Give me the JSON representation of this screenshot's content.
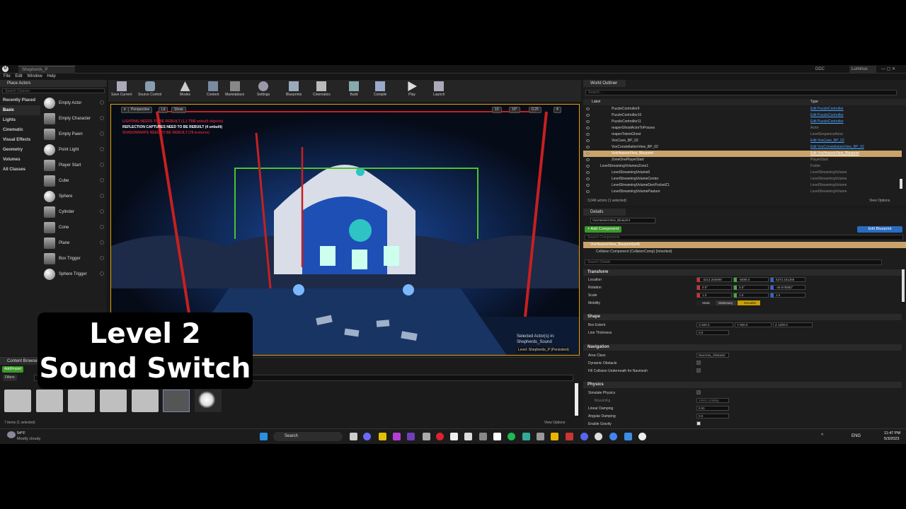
{
  "window": {
    "tab_title": "Shepherds_P",
    "ddc": "DDC",
    "project": "Luminus"
  },
  "menu": [
    "File",
    "Edit",
    "Window",
    "Help"
  ],
  "place_actors": {
    "tab": "Place Actors",
    "search_placeholder": "Search Classes",
    "categories": [
      "Recently Placed",
      "Basic",
      "Lights",
      "Cinematic",
      "Visual Effects",
      "Geometry",
      "Volumes",
      "All Classes"
    ],
    "selected_category": "Basic",
    "items": [
      "Empty Actor",
      "Empty Character",
      "Empty Pawn",
      "Point Light",
      "Player Start",
      "Cube",
      "Sphere",
      "Cylinder",
      "Cone",
      "Plane",
      "Box Trigger",
      "Sphere Trigger"
    ]
  },
  "toolbar": [
    "Save Current",
    "Source Control",
    "Modes",
    "Content",
    "Marketplace",
    "Settings",
    "Blueprints",
    "Cinematics",
    "Build",
    "Compile",
    "Play",
    "Launch"
  ],
  "viewport": {
    "perspective": "Perspective",
    "lit": "Lit",
    "show": "Show",
    "snap_values": [
      "10",
      "10°",
      "0.25",
      "4"
    ],
    "warnings": [
      "LIGHTING NEEDS TO BE REBUILT (1.1 TBB unbuilt objects)",
      "REFLECTION CAPTURES NEED TO BE REBUILT (4 unbuilt)",
      "SHADOWMAPS NEED TO BE REBUILT (78 textures)"
    ],
    "selected_label": "Selected Actor(s) in:",
    "selected_value": "Shepherds_Sound",
    "level_label": "Level:  Shepherds_P (Persistent)"
  },
  "content_browser": {
    "tab": "Content Browser",
    "add_import": "Add/Import",
    "filters": "Filters",
    "status": "7 items (1 selected)",
    "view_options": "View Options"
  },
  "overlay": {
    "line1": "Level 2",
    "line2": "Sound Switch"
  },
  "outliner": {
    "tab": "World Outliner",
    "search_placeholder": "Search...",
    "col_label": "Label",
    "col_type": "Type",
    "rows": [
      {
        "label": "PuzzleController9",
        "type": "Edit PuzzleController",
        "link": true,
        "indent": 1
      },
      {
        "label": "PuzzleController10",
        "type": "Edit PuzzleController",
        "link": true,
        "indent": 1
      },
      {
        "label": "PuzzleController11",
        "type": "Edit PuzzleController",
        "link": true,
        "indent": 1
      },
      {
        "label": "reaperGhostActorToPosses",
        "type": "Actor",
        "link": false,
        "indent": 1
      },
      {
        "label": "reaperTotemGhost",
        "type": "LevelSequenceActor",
        "link": false,
        "indent": 1
      },
      {
        "label": "VoxCave_BP_02",
        "type": "Edit VoxCave_BP_02",
        "link": true,
        "indent": 1
      },
      {
        "label": "VoxConstellationView_BP_02",
        "type": "Edit VoxConstellationView_BP_02",
        "link": true,
        "indent": 1
      },
      {
        "label": "VoxHeavenView_Blueprint",
        "type": "Edit VoxHeavenView_Blueprint",
        "link": true,
        "indent": 1,
        "selected": true
      },
      {
        "label": "ZoneOnePlayerStart",
        "type": "PlayerStart",
        "link": false,
        "indent": 1
      },
      {
        "label": "LevelStreamingVolumesZone1",
        "type": "Folder",
        "link": false,
        "indent": 0
      },
      {
        "label": "LevelStreamingVolume6",
        "type": "LevelStreamingVolume",
        "link": false,
        "indent": 1
      },
      {
        "label": "LevelStreamingVolumeCenter",
        "type": "LevelStreamingVolume",
        "link": false,
        "indent": 1
      },
      {
        "label": "LevelStreamingVolumeDenPocketZ1",
        "type": "LevelStreamingVolume",
        "link": false,
        "indent": 1
      },
      {
        "label": "LevelStreamingVolumePasture",
        "type": "LevelStreamingVolume",
        "link": false,
        "indent": 1
      }
    ],
    "status": "3,046 actors (1 selected)",
    "view_options": "View Options"
  },
  "details": {
    "tab": "Details",
    "name_field": "VoxHeavenView_Blueprint",
    "add_component": "+ Add Component",
    "edit_blueprint": "Edit Blueprint",
    "search_components": "Search Components",
    "root_component": "VoxHeavenView_Blueprint(self)",
    "collision_component": "Collision Component (CollisionComp) (Inherited)",
    "search_details": "Search Details",
    "sections": {
      "transform": "Transform",
      "shape": "Shape",
      "navigation": "Navigation",
      "physics": "Physics"
    },
    "location": {
      "label": "Location",
      "x": "-3213.266969",
      "y": "-5589.0",
      "z": "5373.151266"
    },
    "rotation": {
      "label": "Rotation",
      "x": "0.0°",
      "y": "0.0°",
      "z": "-49.675982°"
    },
    "scale": {
      "label": "Scale",
      "x": "1.0",
      "y": "1.0",
      "z": "1.0"
    },
    "mobility": {
      "label": "Mobility",
      "options": [
        "Static",
        "Stationary",
        "Movable"
      ],
      "selected": "Movable"
    },
    "box_extent": {
      "label": "Box Extent",
      "x": "X 600.0",
      "y": "Y 800.0",
      "z": "Z 1200.0"
    },
    "line_thickness": {
      "label": "Line Thickness",
      "value": "0.0"
    },
    "area_class": {
      "label": "Area Class",
      "value": "NavArea_Obstacle"
    },
    "dynamic_obstacle": "Dynamic Obstacle",
    "fill_collision": "Fill Collision Underneath for Navmesh",
    "simulate_physics": "Simulate Physics",
    "mass_kg": "MassInKg",
    "mass_value": "10931.2258kg",
    "linear_damping": {
      "label": "Linear Damping",
      "value": "0.01"
    },
    "angular_damping": {
      "label": "Angular Damping",
      "value": "0.0"
    },
    "enable_gravity": "Enable Gravity"
  },
  "taskbar": {
    "weather_temp": "54°F",
    "weather_desc": "Mostly cloudy",
    "search": "Search",
    "lang": "ENG",
    "time": "11:47 PM",
    "date": "5/3/2023"
  }
}
